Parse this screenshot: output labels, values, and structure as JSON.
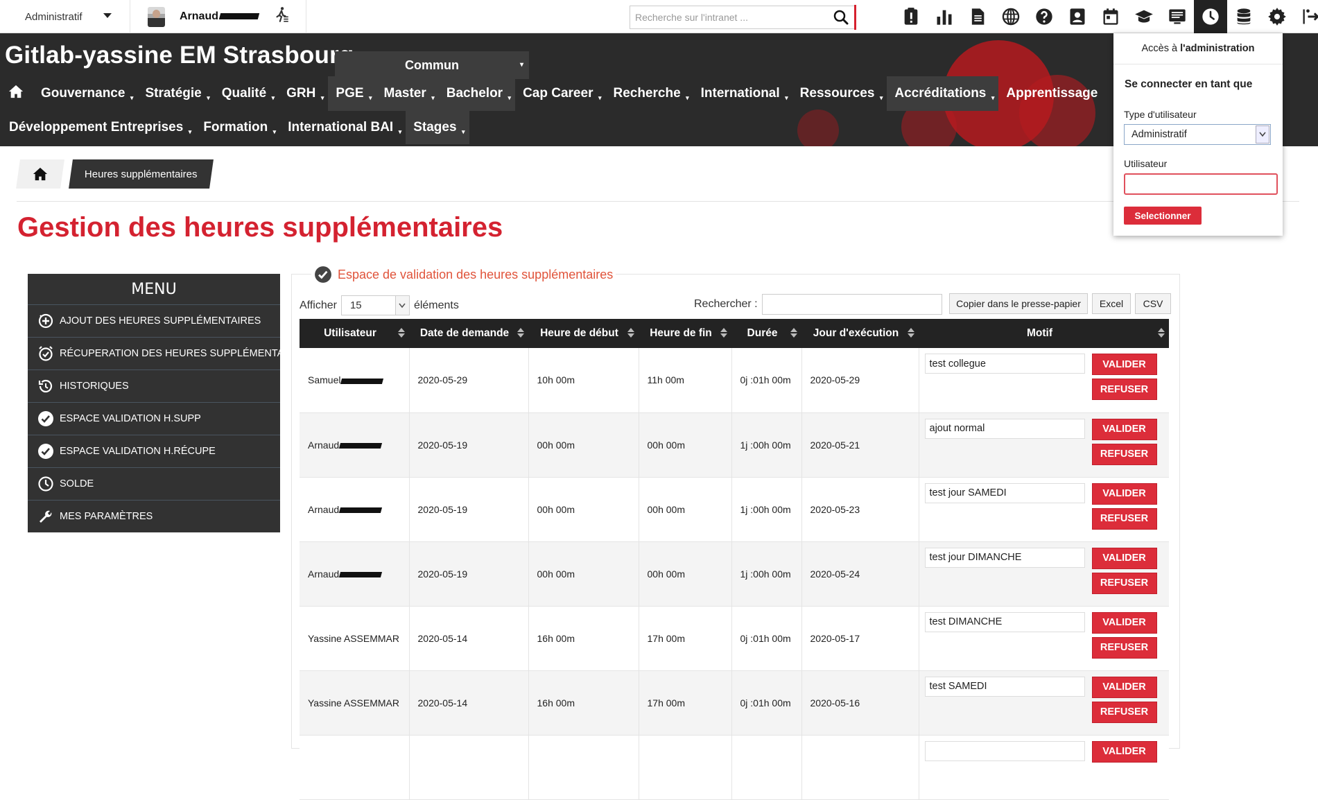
{
  "topbar": {
    "role": "Administratif",
    "user_name": "Arnaud",
    "search_placeholder": "Recherche sur l'intranet ...",
    "tool_icons": [
      "alert-clipboard-icon",
      "bar-chart-icon",
      "document-icon",
      "globe-icon",
      "help-icon",
      "contact-card-icon",
      "calendar-icon",
      "graduation-cap-icon",
      "screen-icon",
      "clock-icon",
      "database-icon",
      "gear-icon",
      "logout-icon"
    ],
    "active_icon": "clock-icon"
  },
  "header": {
    "site_title": "Gitlab-yassine EM Strasbourg",
    "commun": "Commun",
    "nav_row1": [
      "Gouvernance",
      "Stratégie",
      "Qualité",
      "GRH",
      "PGE",
      "Master",
      "Bachelor",
      "Cap Career",
      "Recherche",
      "International",
      "Ressources",
      "Accréditations",
      "Apprentissage"
    ],
    "nav_row2": [
      "Développement Entreprises",
      "Formation",
      "International BAI",
      "Stages"
    ]
  },
  "breadcrumb": {
    "current": "Heures supplémentaires"
  },
  "page_title": "Gestion des heures supplémentaires",
  "menu": {
    "title": "MENU",
    "items": [
      {
        "label": "AJOUT DES HEURES SUPPLÉMENTAIRES",
        "icon": "add-circle-icon"
      },
      {
        "label": "RÉCUPERATION DES HEURES SUPPLÉMENTAIRES",
        "icon": "alarm-check-icon"
      },
      {
        "label": "HISTORIQUES",
        "icon": "history-icon"
      },
      {
        "label": "ESPACE VALIDATION H.SUPP",
        "icon": "check-circle-icon"
      },
      {
        "label": "ESPACE VALIDATION H.RÉCUPE",
        "icon": "check-circle-icon"
      },
      {
        "label": "SOLDE",
        "icon": "clock-icon"
      },
      {
        "label": "MES PARAMÈTRES",
        "icon": "wrench-icon"
      }
    ]
  },
  "panel": {
    "legend": "Espace de validation des heures supplémentaires",
    "show_label": "Afficher",
    "show_value": "15",
    "entries_label": "éléments",
    "search_label": "Rechercher :",
    "buttons": {
      "copy": "Copier dans le presse-papier",
      "excel": "Excel",
      "csv": "CSV"
    }
  },
  "table": {
    "columns": [
      "Utilisateur",
      "Date de demande",
      "Heure de début",
      "Heure de fin",
      "Durée",
      "Jour d'exécution",
      "Motif"
    ],
    "rows": [
      {
        "user": "Samuel",
        "redacted": true,
        "date": "2020-05-29",
        "start": "10h 00m",
        "end": "11h 00m",
        "duration": "0j :01h 00m",
        "exec": "2020-05-29",
        "motif": "test collegue"
      },
      {
        "user": "Arnaud",
        "redacted": true,
        "date": "2020-05-19",
        "start": "00h 00m",
        "end": "00h 00m",
        "duration": "1j :00h 00m",
        "exec": "2020-05-21",
        "motif": "ajout normal"
      },
      {
        "user": "Arnaud",
        "redacted": true,
        "date": "2020-05-19",
        "start": "00h 00m",
        "end": "00h 00m",
        "duration": "1j :00h 00m",
        "exec": "2020-05-23",
        "motif": "test jour SAMEDI"
      },
      {
        "user": "Arnaud",
        "redacted": true,
        "date": "2020-05-19",
        "start": "00h 00m",
        "end": "00h 00m",
        "duration": "1j :00h 00m",
        "exec": "2020-05-24",
        "motif": "test jour DIMANCHE"
      },
      {
        "user": "Yassine ASSEMMAR",
        "redacted": false,
        "date": "2020-05-14",
        "start": "16h 00m",
        "end": "17h 00m",
        "duration": "0j :01h 00m",
        "exec": "2020-05-17",
        "motif": "test DIMANCHE"
      },
      {
        "user": "Yassine ASSEMMAR",
        "redacted": false,
        "date": "2020-05-14",
        "start": "16h 00m",
        "end": "17h 00m",
        "duration": "0j :01h 00m",
        "exec": "2020-05-16",
        "motif": "test SAMEDI"
      }
    ],
    "validate_label": "VALIDER",
    "refuse_label": "REFUSER"
  },
  "admin_panel": {
    "link_prefix": "Accès à ",
    "link_strong": "l'administration",
    "heading": "Se connecter en tant que",
    "type_label": "Type d'utilisateur",
    "type_value": "Administratif",
    "user_label": "Utilisateur",
    "submit": "Selectionner"
  },
  "colors": {
    "accent": "#dc2d3a",
    "title_red": "#d42230",
    "dark": "#2b2b2b",
    "legend_orange": "#e0533a"
  }
}
